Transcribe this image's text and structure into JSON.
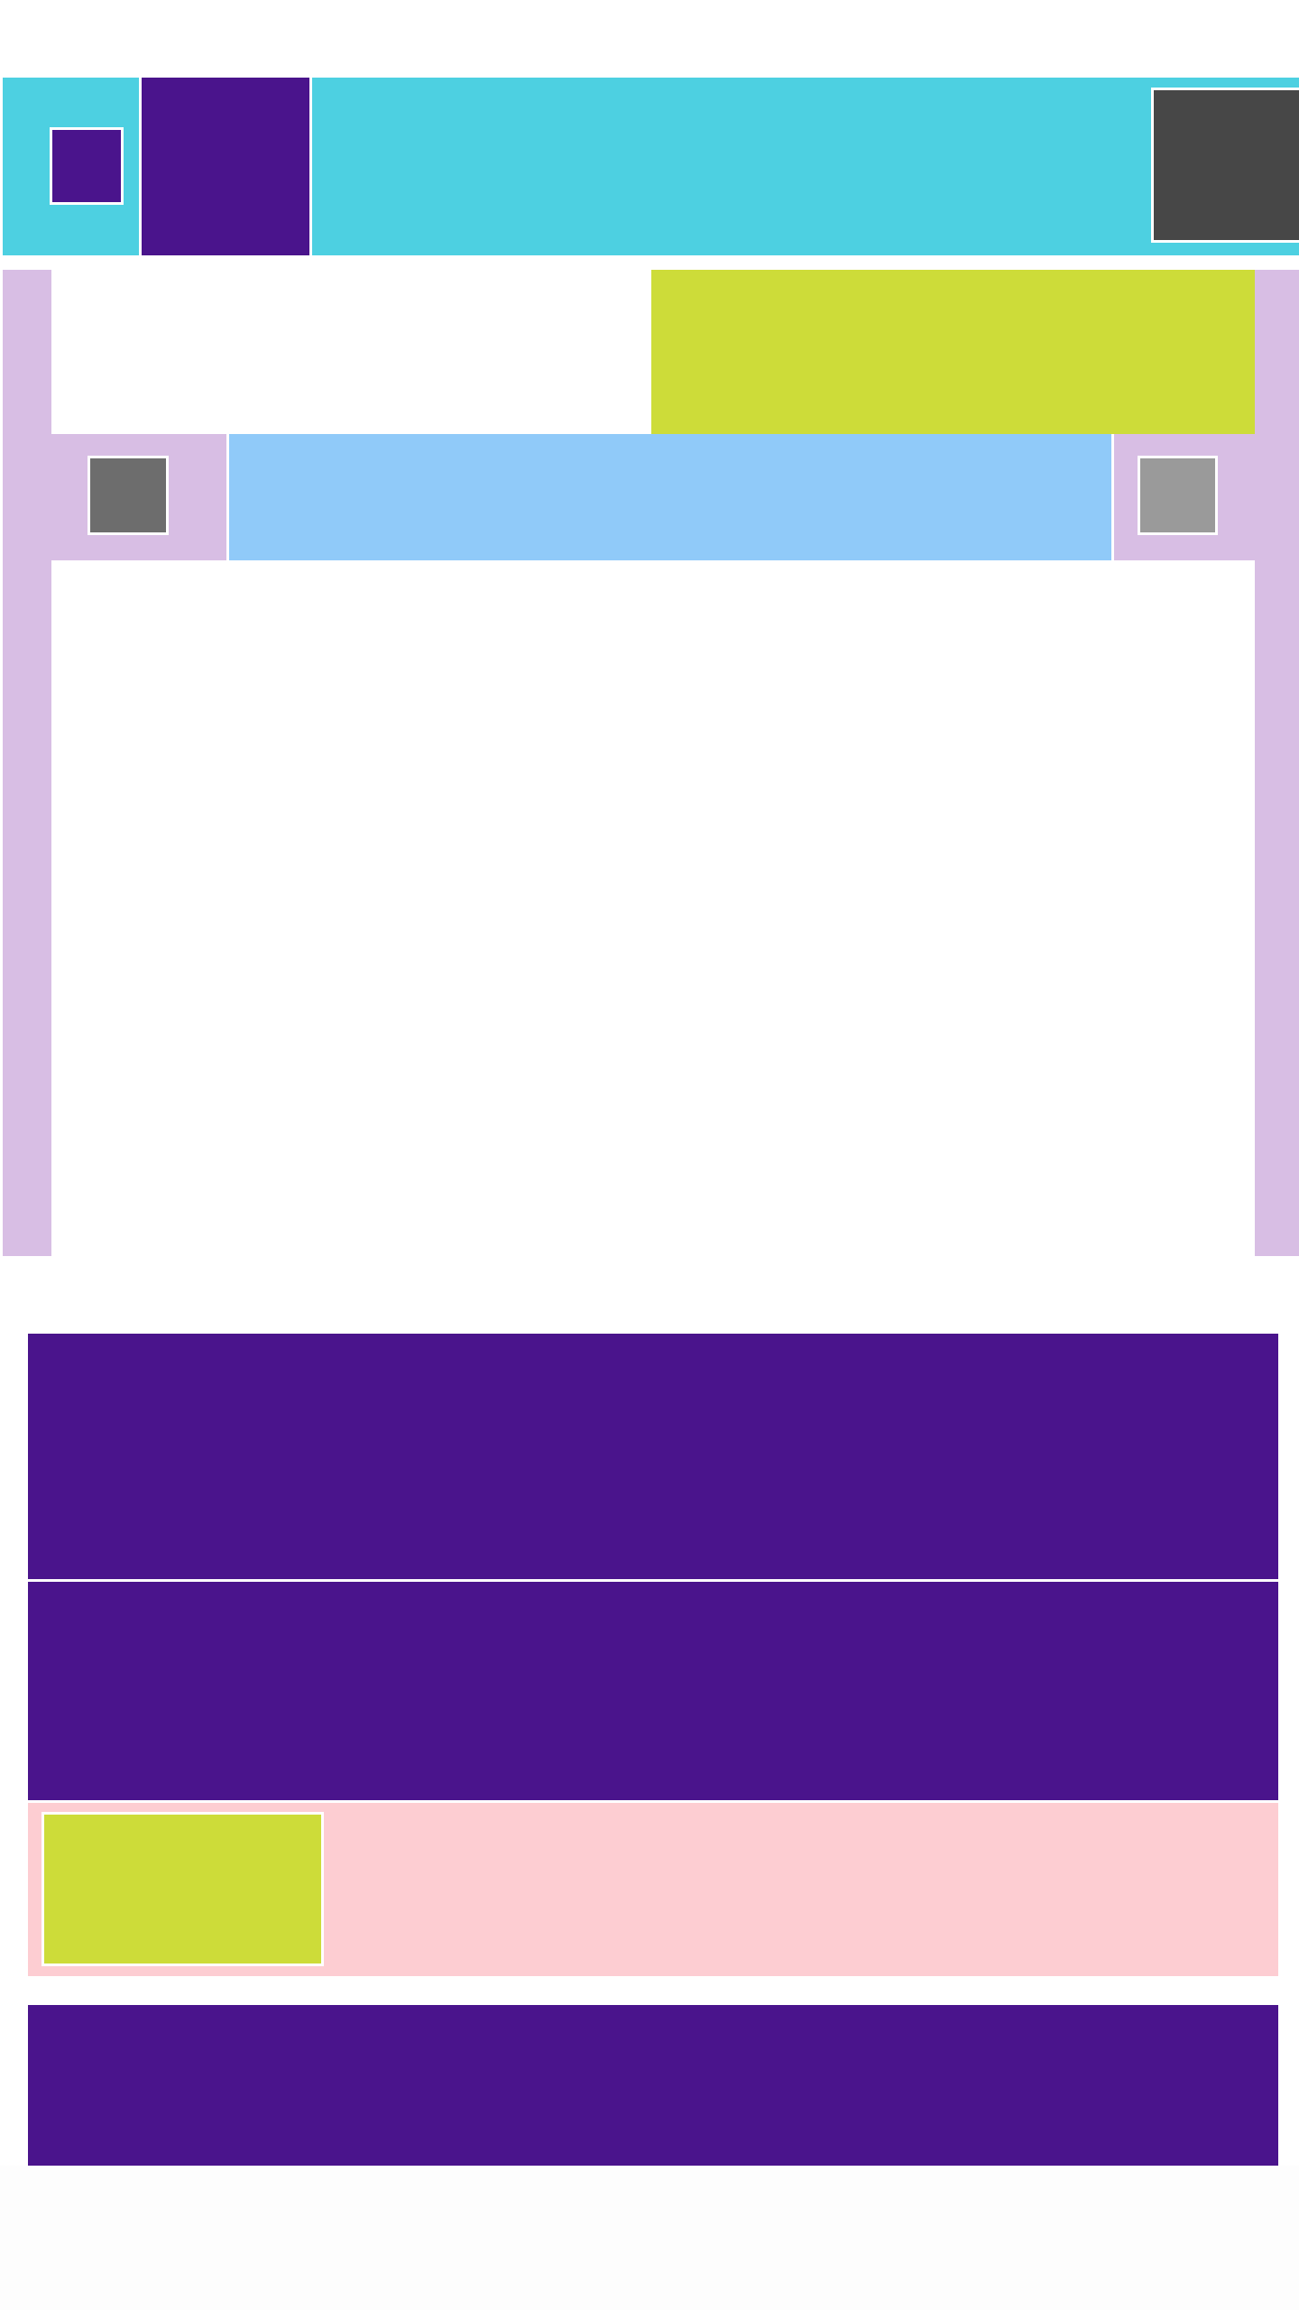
{
  "colors": {
    "header_bg": "#4dd0e1",
    "brand_purple": "#4a148c",
    "profile_bg": "#474747",
    "card_gutter": "#d8bee4",
    "promo_lime": "#cddc39",
    "search_blue": "#90caf9",
    "prev_gray": "#6d6d6d",
    "next_gray": "#9a9a9a",
    "list_pink": "#fdcdd2",
    "thumb_lime": "#cddc39",
    "footer_purple": "#4a148c"
  },
  "icons": {
    "menu": "menu-icon",
    "profile": "avatar-icon",
    "prev": "chevron-left-icon",
    "next": "chevron-right-icon",
    "thumbnail": "image-icon"
  },
  "header": {},
  "card": {
    "promo": {},
    "nav": {},
    "search": {}
  },
  "list": {
    "items": [
      {},
      {},
      {}
    ]
  },
  "footer": {}
}
